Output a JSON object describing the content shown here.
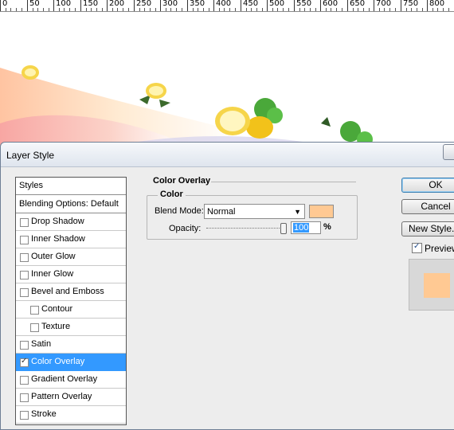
{
  "ruler": {
    "labels": [
      "0",
      "50",
      "100",
      "150",
      "200",
      "250",
      "300",
      "350",
      "400",
      "450",
      "500",
      "550",
      "600",
      "650",
      "700",
      "750",
      "800"
    ]
  },
  "dialog": {
    "title": "Layer Style",
    "styles_panel": {
      "header": "Styles",
      "blending": "Blending Options: Default",
      "items": [
        {
          "label": "Drop Shadow",
          "checked": false,
          "selected": false,
          "indent": false
        },
        {
          "label": "Inner Shadow",
          "checked": false,
          "selected": false,
          "indent": false
        },
        {
          "label": "Outer Glow",
          "checked": false,
          "selected": false,
          "indent": false
        },
        {
          "label": "Inner Glow",
          "checked": false,
          "selected": false,
          "indent": false
        },
        {
          "label": "Bevel and Emboss",
          "checked": false,
          "selected": false,
          "indent": false
        },
        {
          "label": "Contour",
          "checked": false,
          "selected": false,
          "indent": true
        },
        {
          "label": "Texture",
          "checked": false,
          "selected": false,
          "indent": true
        },
        {
          "label": "Satin",
          "checked": false,
          "selected": false,
          "indent": false
        },
        {
          "label": "Color Overlay",
          "checked": true,
          "selected": true,
          "indent": false
        },
        {
          "label": "Gradient Overlay",
          "checked": false,
          "selected": false,
          "indent": false
        },
        {
          "label": "Pattern Overlay",
          "checked": false,
          "selected": false,
          "indent": false
        },
        {
          "label": "Stroke",
          "checked": false,
          "selected": false,
          "indent": false
        }
      ]
    },
    "panel": {
      "section_title": "Color Overlay",
      "group_title": "Color",
      "blend_mode_label": "Blend Mode:",
      "blend_mode_value": "Normal",
      "overlay_color": "#ffc993",
      "opacity_label": "Opacity:",
      "opacity_value": "100",
      "opacity_unit": "%"
    },
    "buttons": {
      "ok": "OK",
      "cancel": "Cancel",
      "new_style": "New Style..."
    },
    "preview": {
      "label": "Preview",
      "checked": true
    }
  }
}
